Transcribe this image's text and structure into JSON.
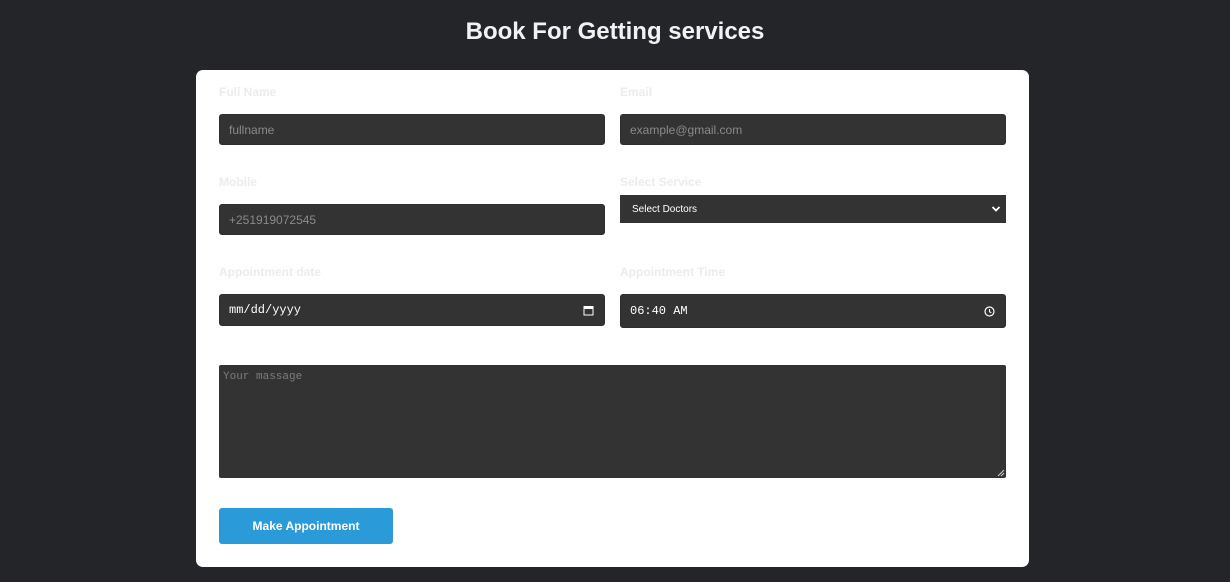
{
  "page": {
    "title": "Book For Getting services"
  },
  "form": {
    "full_name": {
      "label": "Full Name",
      "placeholder": "fullname"
    },
    "email": {
      "label": "Email",
      "placeholder": "example@gmail.com"
    },
    "mobile": {
      "label": "Mobile",
      "placeholder": "+251919072545"
    },
    "service": {
      "label": "Select Service",
      "selected": "Select Doctors"
    },
    "appointment_date": {
      "label": "Appointment date",
      "value": "mm/dd/yyyy"
    },
    "appointment_time": {
      "label": "Appointment Time",
      "value": "06:40 AM"
    },
    "message": {
      "placeholder": "Your massage"
    },
    "submit_label": "Make Appointment"
  },
  "icons": {
    "select_arrow": "chevron-down-icon",
    "date_picker": "calendar-icon",
    "time_picker": "clock-icon",
    "textarea_resize": "resize-grip-icon"
  },
  "colors": {
    "background": "#242529",
    "card": "#ffffff",
    "field": "#333333",
    "button": "#2a9ad8"
  }
}
